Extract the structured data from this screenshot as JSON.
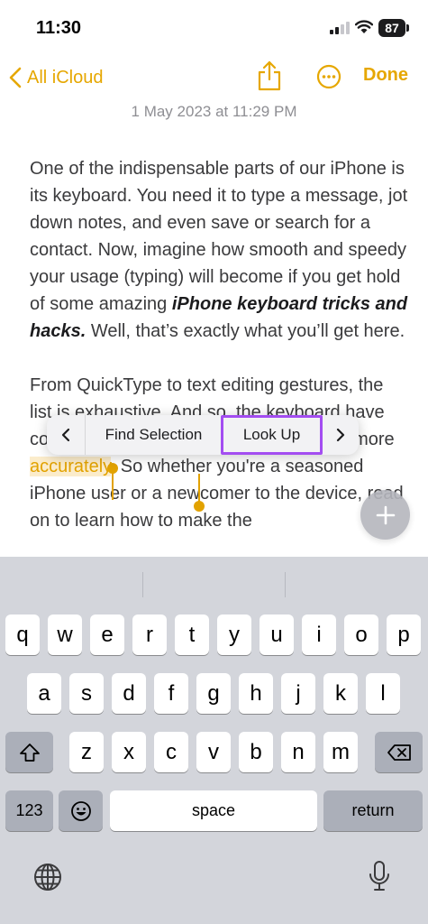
{
  "status_bar": {
    "time": "11:30",
    "battery": "87"
  },
  "nav": {
    "back_label": "All iCloud",
    "done_label": "Done"
  },
  "note": {
    "date": "1 May 2023 at 11:29 PM",
    "para1_text": "One of the indispensable parts of our iPhone is its keyboard. You need it to type a message, jot down notes, and even save or search for a contact. Now, imagine how smooth and speedy your usage (typing) will become if you get hold of some amazing ",
    "para1_bold": "iPhone keyboard tricks and hacks.",
    "para1_end": " Well, that’s exactly what you’ll get here.",
    "para2_before": "From QuickType to text editing gestures, the list is exhaustive. And so, the keyboard have covered it all to help you type faster and more ",
    "para2_selected": "accurately",
    "para2_after": ". So whether you're a seasoned iPhone user or a newcomer to the device, read on to learn how to make the"
  },
  "context_menu": {
    "find_selection": "Find Selection",
    "look_up": "Look Up"
  },
  "keyboard": {
    "row1": [
      "q",
      "w",
      "e",
      "r",
      "t",
      "y",
      "u",
      "i",
      "o",
      "p"
    ],
    "row2": [
      "a",
      "s",
      "d",
      "f",
      "g",
      "h",
      "j",
      "k",
      "l"
    ],
    "row3": [
      "z",
      "x",
      "c",
      "v",
      "b",
      "n",
      "m"
    ],
    "numbers_label": "123",
    "space_label": "space",
    "return_label": "return"
  },
  "colors": {
    "accent": "#e6a700",
    "highlight": "#a34df1",
    "selection": "#e2a200"
  }
}
